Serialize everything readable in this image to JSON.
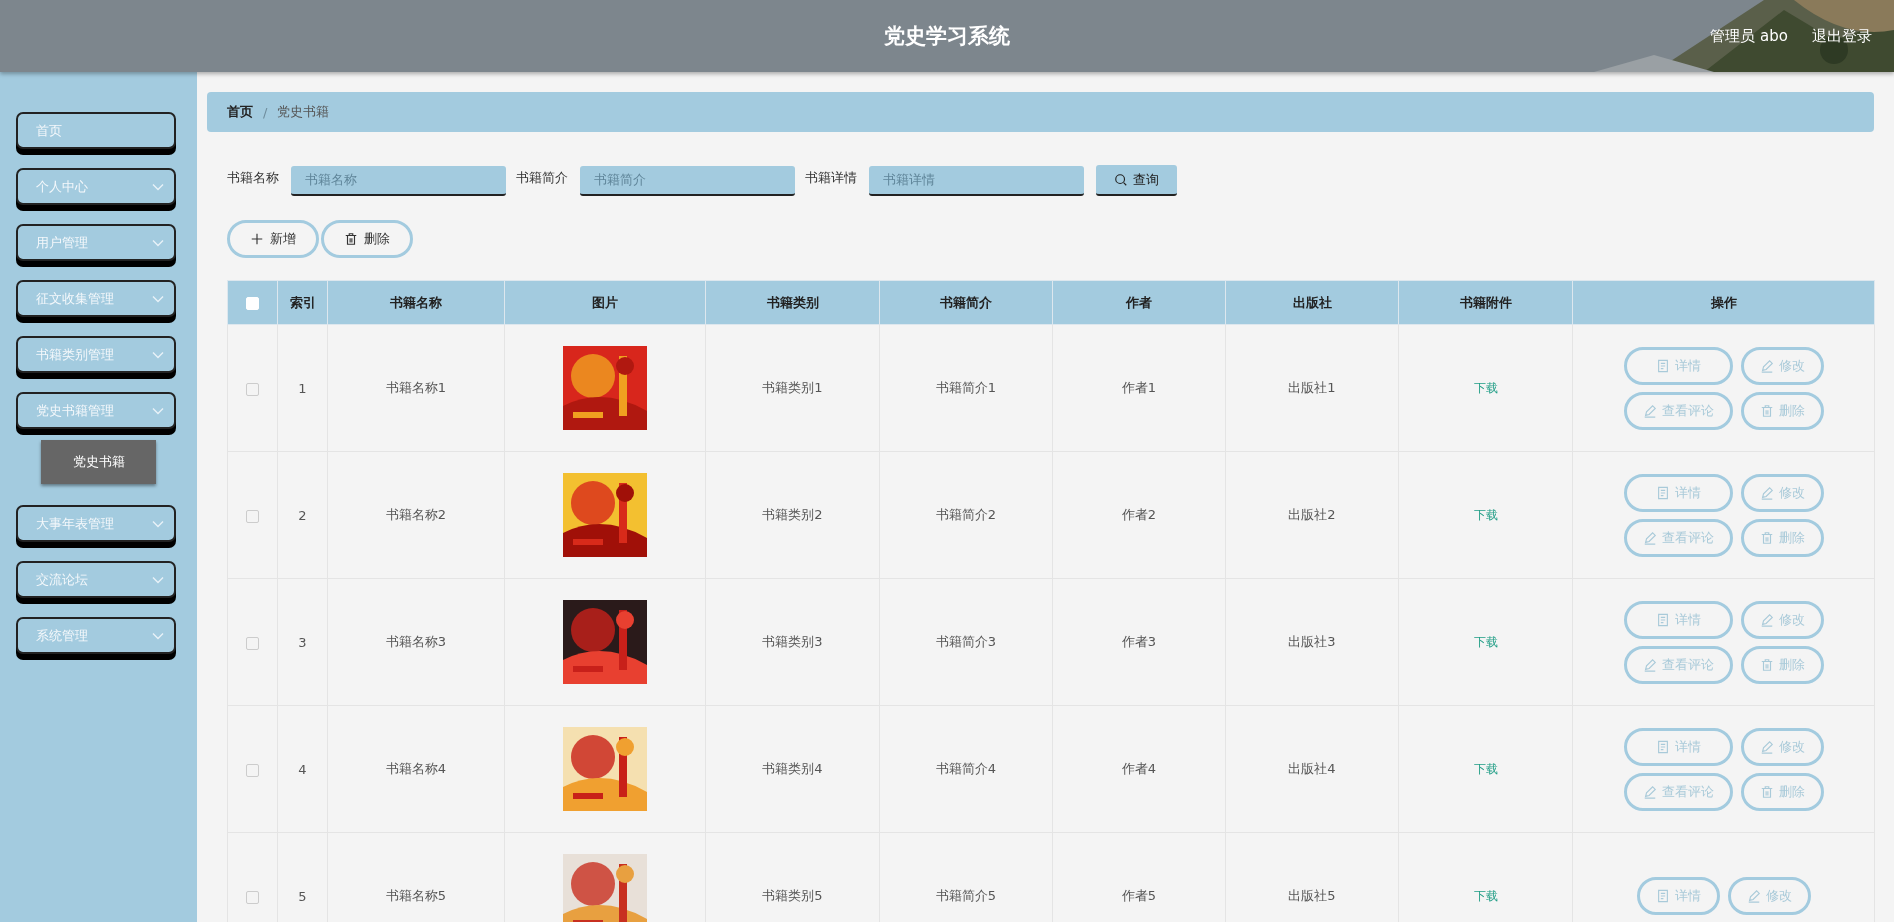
{
  "header": {
    "title": "党史学习系统",
    "user": "管理员 abo",
    "logout": "退出登录"
  },
  "sidebar": {
    "items": [
      {
        "label": "首页",
        "expandable": false
      },
      {
        "label": "个人中心",
        "expandable": true,
        "expanded": false
      },
      {
        "label": "用户管理",
        "expandable": true,
        "expanded": false
      },
      {
        "label": "征文收集管理",
        "expandable": true,
        "expanded": false
      },
      {
        "label": "书籍类别管理",
        "expandable": true,
        "expanded": false
      },
      {
        "label": "党史书籍管理",
        "expandable": true,
        "expanded": true,
        "children": [
          {
            "label": "党史书籍",
            "selected": true
          }
        ]
      },
      {
        "label": "大事年表管理",
        "expandable": true,
        "expanded": false
      },
      {
        "label": "交流论坛",
        "expandable": true,
        "expanded": false
      },
      {
        "label": "系统管理",
        "expandable": true,
        "expanded": false
      }
    ]
  },
  "breadcrumb": {
    "items": [
      "首页",
      "党史书籍"
    ],
    "separator": "/"
  },
  "search": {
    "fields": [
      {
        "label": "书籍名称",
        "placeholder": "书籍名称"
      },
      {
        "label": "书籍简介",
        "placeholder": "书籍简介"
      },
      {
        "label": "书籍详情",
        "placeholder": "书籍详情"
      }
    ],
    "button": "查询"
  },
  "toolbar": [
    {
      "label": "新增",
      "kind": "add"
    },
    {
      "label": "删除",
      "kind": "delete"
    }
  ],
  "table": {
    "header_checkbox": {
      "checked": false
    },
    "columns": [
      "索引",
      "书籍名称",
      "图片",
      "书籍类别",
      "书籍简介",
      "作者",
      "出版社",
      "书籍附件",
      "操作"
    ],
    "rows": [
      {
        "checked": false,
        "index": "1",
        "name": "书籍名称1",
        "image": {
          "kind": "picture"
        },
        "category": "书籍类别1",
        "intro": "书籍简介1",
        "author": "作者1",
        "publisher": "出版社1",
        "attachment": "下载",
        "actions": [
          {
            "label": "详情",
            "kind": "detail"
          },
          {
            "label": "修改",
            "kind": "edit"
          },
          {
            "label": "查看评论",
            "kind": "edit"
          },
          {
            "label": "删除",
            "kind": "delete"
          }
        ]
      },
      {
        "checked": false,
        "index": "2",
        "name": "书籍名称2",
        "image": {
          "kind": "picture"
        },
        "category": "书籍类别2",
        "intro": "书籍简介2",
        "author": "作者2",
        "publisher": "出版社2",
        "attachment": "下载",
        "actions": [
          {
            "label": "详情",
            "kind": "detail"
          },
          {
            "label": "修改",
            "kind": "edit"
          },
          {
            "label": "查看评论",
            "kind": "edit"
          },
          {
            "label": "删除",
            "kind": "delete"
          }
        ]
      },
      {
        "checked": false,
        "index": "3",
        "name": "书籍名称3",
        "image": {
          "kind": "picture"
        },
        "category": "书籍类别3",
        "intro": "书籍简介3",
        "author": "作者3",
        "publisher": "出版社3",
        "attachment": "下载",
        "actions": [
          {
            "label": "详情",
            "kind": "detail"
          },
          {
            "label": "修改",
            "kind": "edit"
          },
          {
            "label": "查看评论",
            "kind": "edit"
          },
          {
            "label": "删除",
            "kind": "delete"
          }
        ]
      },
      {
        "checked": false,
        "index": "4",
        "name": "书籍名称4",
        "image": {
          "kind": "picture"
        },
        "category": "书籍类别4",
        "intro": "书籍简介4",
        "author": "作者4",
        "publisher": "出版社4",
        "attachment": "下载",
        "actions": [
          {
            "label": "详情",
            "kind": "detail"
          },
          {
            "label": "修改",
            "kind": "edit"
          },
          {
            "label": "查看评论",
            "kind": "edit"
          },
          {
            "label": "删除",
            "kind": "delete"
          }
        ]
      },
      {
        "checked": false,
        "index": "5",
        "name": "书籍名称5",
        "image": {
          "kind": "picture"
        },
        "category": "书籍类别5",
        "intro": "书籍简介5",
        "author": "作者5",
        "publisher": "出版社5",
        "attachment": "下载",
        "actions": [
          {
            "label": "详情",
            "kind": "detail"
          },
          {
            "label": "修改",
            "kind": "edit"
          }
        ]
      }
    ]
  }
}
